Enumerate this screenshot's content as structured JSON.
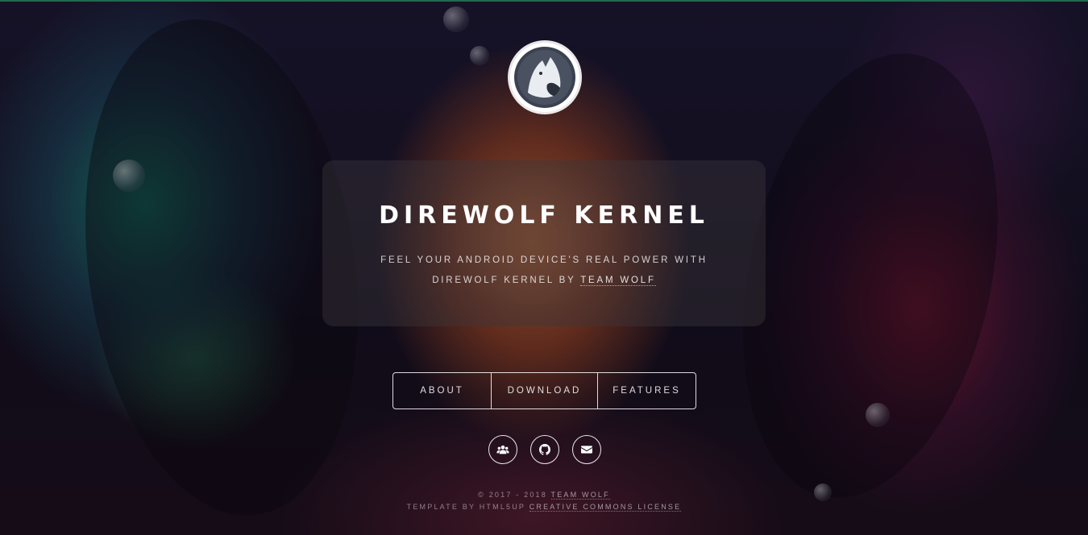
{
  "header": {
    "title": "DIREWOLF KERNEL",
    "tagline_before": "Feel your Android device's real power with Direwolf Kernel by",
    "tagline_link": "Team Wolf"
  },
  "nav": {
    "items": [
      {
        "label": "About"
      },
      {
        "label": "Download"
      },
      {
        "label": "Features"
      }
    ]
  },
  "socials": [
    {
      "icon": "users-icon"
    },
    {
      "icon": "github-icon"
    },
    {
      "icon": "envelope-icon"
    }
  ],
  "footer": {
    "copyright_prefix": "© 2017 - 2018",
    "copyright_link": "Team Wolf",
    "credit_prefix": "Template by HTML5UP",
    "license_link": "Creative Commons License"
  },
  "colors": {
    "accent": "#ffffff",
    "panel": "#3c383c",
    "background": "#140f1e"
  }
}
